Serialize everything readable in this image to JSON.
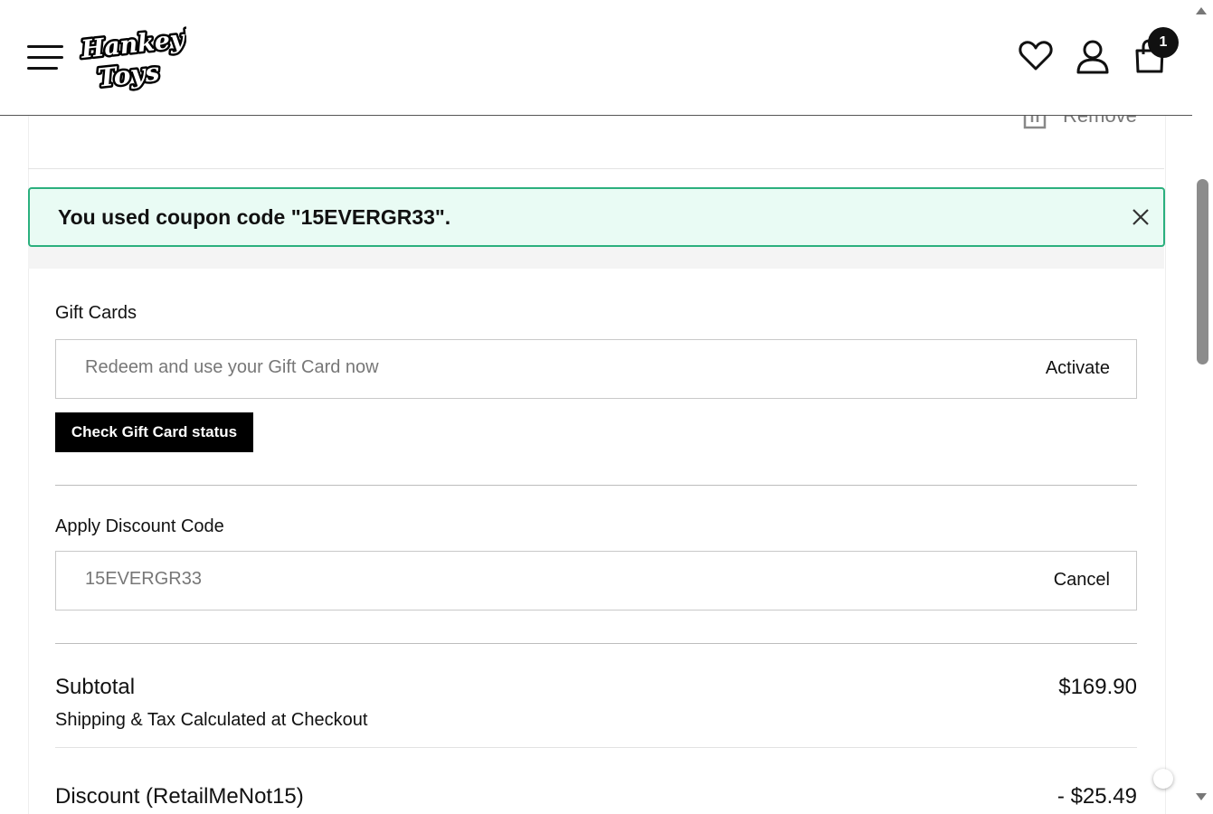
{
  "header": {
    "logo_text_line1": "Hankey's",
    "logo_text_line2": "Toys",
    "cart_count": "1"
  },
  "cart_item": {
    "remove_label": "Remove"
  },
  "alert": {
    "message": "You used coupon code \"15EVERGR33\"."
  },
  "gift_cards": {
    "title": "Gift Cards",
    "placeholder": "Redeem and use your Gift Card now",
    "activate_label": "Activate",
    "check_status_label": "Check Gift Card status"
  },
  "discount": {
    "title": "Apply Discount Code",
    "value": "15EVERGR33",
    "cancel_label": "Cancel"
  },
  "totals": {
    "subtotal_label": "Subtotal",
    "subtotal_value": "$169.90",
    "shipping_note": "Shipping & Tax Calculated at Checkout",
    "discount_label": "Discount (RetailMeNot15)",
    "discount_value": "- $25.49"
  }
}
